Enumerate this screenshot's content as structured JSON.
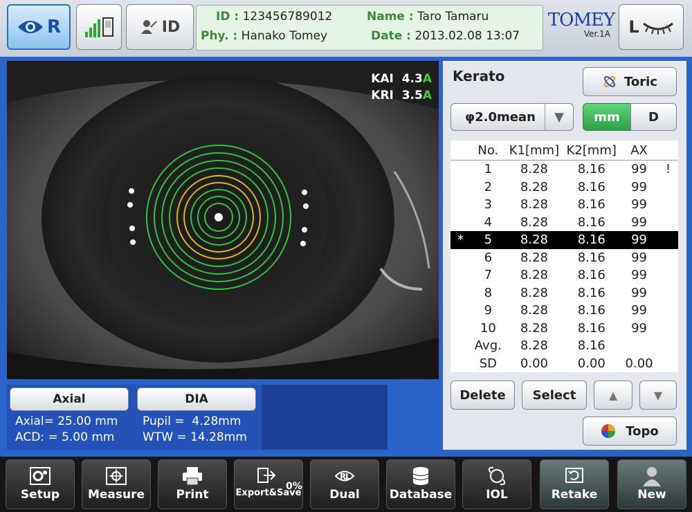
{
  "header": {
    "eye_side": "R",
    "id_button": "ID",
    "patient": {
      "id_label": "ID :",
      "id_value": "123456789012",
      "name_label": "Name :",
      "name_value": "Taro Tamaru",
      "phy_label": "Phy. :",
      "phy_value": "Hanako Tomey",
      "date_label": "Date :",
      "date_value": "2013.02.08  13:07"
    },
    "brand": "TOMEY",
    "version": "Ver.1A",
    "other_eye": "L"
  },
  "image": {
    "kai_label": "KAI",
    "kai_value": "4.3",
    "kai_grade": "A",
    "kri_label": "KRI",
    "kri_value": "3.5",
    "kri_grade": "A"
  },
  "kerato": {
    "title": "Kerato",
    "toric_button": "Toric",
    "mode_select": "φ2.0mean",
    "unit_mm": "mm",
    "unit_d": "D",
    "columns": [
      "No.",
      "K1[mm]",
      "K2[mm]",
      "AX"
    ],
    "rows": [
      {
        "mark": "",
        "no": "1",
        "k1": "8.28",
        "k2": "8.16",
        "ax": "99",
        "flag": "!"
      },
      {
        "mark": "",
        "no": "2",
        "k1": "8.28",
        "k2": "8.16",
        "ax": "99",
        "flag": ""
      },
      {
        "mark": "",
        "no": "3",
        "k1": "8.28",
        "k2": "8.16",
        "ax": "99",
        "flag": ""
      },
      {
        "mark": "",
        "no": "4",
        "k1": "8.28",
        "k2": "8.16",
        "ax": "99",
        "flag": ""
      },
      {
        "mark": "*",
        "no": "5",
        "k1": "8.28",
        "k2": "8.16",
        "ax": "99",
        "flag": ""
      },
      {
        "mark": "",
        "no": "6",
        "k1": "8.28",
        "k2": "8.16",
        "ax": "99",
        "flag": ""
      },
      {
        "mark": "",
        "no": "7",
        "k1": "8.28",
        "k2": "8.16",
        "ax": "99",
        "flag": ""
      },
      {
        "mark": "",
        "no": "8",
        "k1": "8.28",
        "k2": "8.16",
        "ax": "99",
        "flag": ""
      },
      {
        "mark": "",
        "no": "9",
        "k1": "8.28",
        "k2": "8.16",
        "ax": "99",
        "flag": ""
      },
      {
        "mark": "",
        "no": "10",
        "k1": "8.28",
        "k2": "8.16",
        "ax": "99",
        "flag": ""
      },
      {
        "mark": "",
        "no": "Avg.",
        "k1": "8.28",
        "k2": "8.16",
        "ax": "",
        "flag": ""
      },
      {
        "mark": "",
        "no": "SD",
        "k1": "0.00",
        "k2": "0.00",
        "ax": "0.00",
        "flag": ""
      }
    ],
    "delete_button": "Delete",
    "select_button": "Select",
    "topo_button": "Topo"
  },
  "axial": {
    "button": "Axial",
    "axial_line": "Axial= 25.00 mm",
    "acd_line": "ACD: = 5.00 mm"
  },
  "dia": {
    "button": "DIA",
    "pupil_line": "Pupil =  4.28mm",
    "wtw_line": "WTW = 14.28mm"
  },
  "toolbar": {
    "setup": "Setup",
    "measure": "Measure",
    "print": "Print",
    "export": "Export&Save",
    "export_percent": "0%",
    "dual": "Dual",
    "database": "Database",
    "iol": "IOL",
    "retake": "Retake",
    "new": "New"
  },
  "colors": {
    "accent_blue": "#2a64c8",
    "ring_green": "#2fc43a",
    "ring_yellow": "#d9b81e",
    "selected_row": "#000000"
  }
}
